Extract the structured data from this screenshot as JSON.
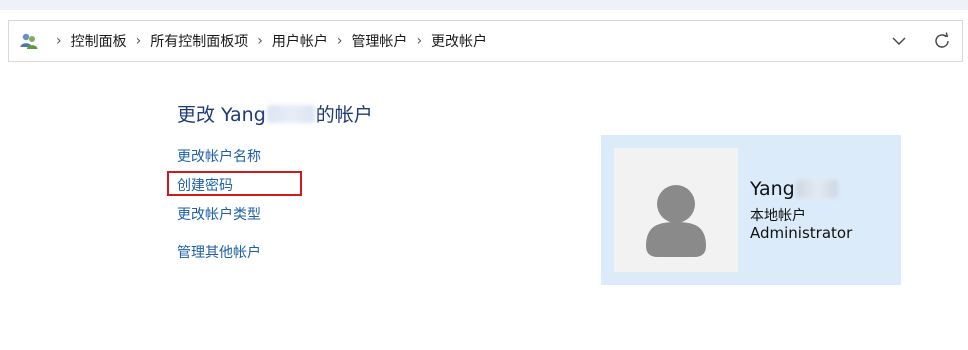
{
  "breadcrumb": {
    "items": [
      "控制面板",
      "所有控制面板项",
      "用户帐户",
      "管理帐户",
      "更改帐户"
    ],
    "separator": "›"
  },
  "page": {
    "title_prefix": "更改 Yang",
    "title_suffix": "的帐户"
  },
  "tasks": {
    "rename": "更改帐户名称",
    "create_password": "创建密码",
    "change_type": "更改帐户类型",
    "manage_other": "管理其他帐户"
  },
  "account": {
    "name": "Yang",
    "type": "本地帐户",
    "role": "Administrator"
  },
  "colors": {
    "link": "#1d5fa8",
    "title": "#1e3a78",
    "highlight": "#cc1b1b",
    "card_bg": "#dcebfa"
  },
  "icons": {
    "address": "users-icon",
    "dropdown": "chevron-down-icon",
    "refresh": "refresh-icon",
    "avatar": "user-avatar-icon"
  }
}
